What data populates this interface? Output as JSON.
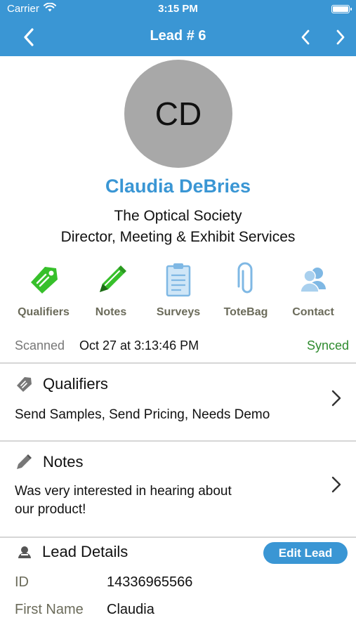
{
  "status_bar": {
    "carrier": "Carrier",
    "time": "3:15 PM",
    "icons": [
      "wifi-icon",
      "battery-icon"
    ]
  },
  "nav": {
    "title": "Lead # 6",
    "icons": [
      "chevron-left-icon",
      "chevron-left-icon",
      "chevron-right-icon"
    ]
  },
  "lead": {
    "initials": "CD",
    "name": "Claudia DeBries",
    "company": "The Optical Society",
    "title": "Director, Meeting & Exhibit Services"
  },
  "actions": [
    {
      "label": "Qualifiers",
      "icon": "tag-icon",
      "color": "#37c02b"
    },
    {
      "label": "Notes",
      "icon": "pencil-icon",
      "color": "#37c02b"
    },
    {
      "label": "Surveys",
      "icon": "clipboard-icon",
      "color": "#7fb8e4"
    },
    {
      "label": "ToteBag",
      "icon": "paperclip-icon",
      "color": "#7fb8e4"
    },
    {
      "label": "Contact",
      "icon": "contacts-icon",
      "color": "#7fb8e4"
    }
  ],
  "scan": {
    "label": "Scanned",
    "value": "Oct 27 at 3:13:46 PM",
    "sync_status": "Synced"
  },
  "qualifiers_section": {
    "heading": "Qualifiers",
    "icon": "tag-icon",
    "text": "Send Samples, Send Pricing, Needs Demo"
  },
  "notes_section": {
    "heading": "Notes",
    "icon": "pencil-icon",
    "text_line1": "Was very interested in hearing about",
    "text_line2": "our product!"
  },
  "details_section": {
    "heading": "Lead Details",
    "icon": "person-icon",
    "edit_label": "Edit Lead",
    "rows": [
      {
        "key": "ID",
        "value": "14336965566"
      },
      {
        "key": "First Name",
        "value": "Claudia"
      }
    ]
  },
  "colors": {
    "accent": "#3a96d4",
    "synced": "#2e8b2e",
    "action_green": "#37c02b",
    "action_blue": "#7fb8e4"
  }
}
